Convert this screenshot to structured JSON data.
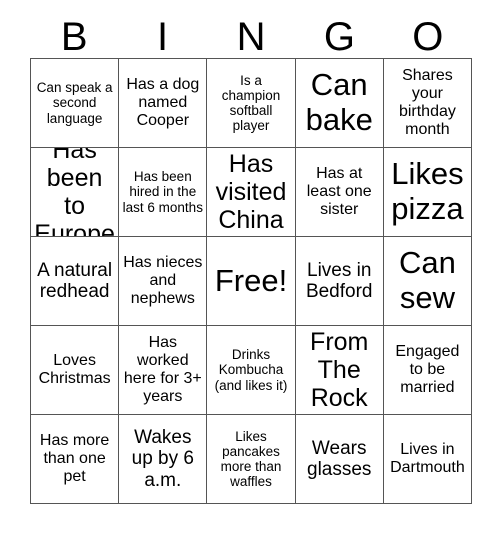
{
  "card": {
    "header_letters": [
      "B",
      "I",
      "N",
      "G",
      "O"
    ],
    "columns": 5,
    "rows": 5,
    "border_color": "#555555",
    "text_color": "#000000",
    "background_color": "#ffffff",
    "cells": [
      [
        {
          "text": "Can speak a second language",
          "size": "xs"
        },
        {
          "text": "Has a dog named Cooper",
          "size": "sm"
        },
        {
          "text": "Is a champion softball player",
          "size": "xs"
        },
        {
          "text": "Can bake",
          "size": "xl"
        },
        {
          "text": "Shares your birthday month",
          "size": "sm"
        }
      ],
      [
        {
          "text": "Has been to Europe",
          "size": "lg"
        },
        {
          "text": "Has been hired in the last 6 months",
          "size": "xs"
        },
        {
          "text": "Has visited China",
          "size": "lg"
        },
        {
          "text": "Has at least one sister",
          "size": "sm"
        },
        {
          "text": "Likes pizza",
          "size": "xl"
        }
      ],
      [
        {
          "text": "A natural redhead",
          "size": "md"
        },
        {
          "text": "Has nieces and nephews",
          "size": "sm"
        },
        {
          "text": "Free!",
          "size": "xl"
        },
        {
          "text": "Lives in Bedford",
          "size": "md"
        },
        {
          "text": "Can sew",
          "size": "xl"
        }
      ],
      [
        {
          "text": "Loves Christmas",
          "size": "sm"
        },
        {
          "text": "Has worked here for 3+ years",
          "size": "sm"
        },
        {
          "text": "Drinks Kombucha (and likes it)",
          "size": "xs"
        },
        {
          "text": "From The Rock",
          "size": "lg"
        },
        {
          "text": "Engaged to be married",
          "size": "sm"
        }
      ],
      [
        {
          "text": "Has more than one pet",
          "size": "sm"
        },
        {
          "text": "Wakes up by 6 a.m.",
          "size": "md"
        },
        {
          "text": "Likes pancakes more than waffles",
          "size": "xs"
        },
        {
          "text": "Wears glasses",
          "size": "md"
        },
        {
          "text": "Lives in Dartmouth",
          "size": "sm"
        }
      ]
    ]
  }
}
